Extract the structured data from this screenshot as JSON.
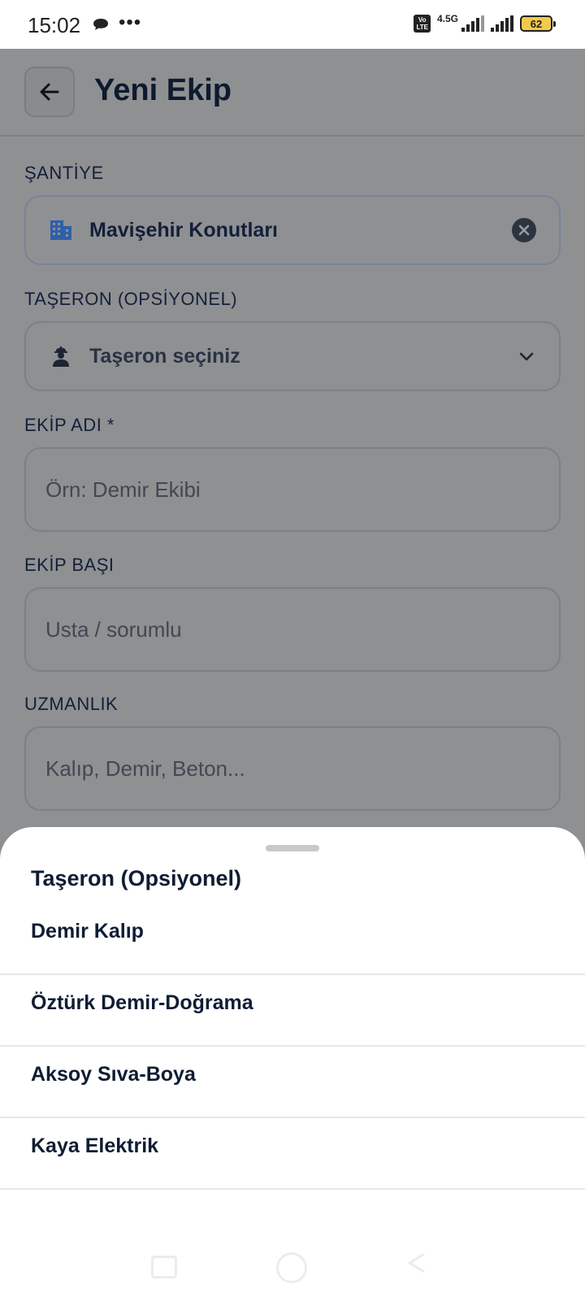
{
  "status_bar": {
    "time": "15:02",
    "network_type": "4.5G",
    "volte_label": "Vo LTE",
    "battery_level": "62",
    "icons": [
      "chat-icon",
      "more-dots-icon",
      "volte-icon",
      "signal-icon",
      "signal-icon",
      "battery-icon"
    ]
  },
  "header": {
    "title": "Yeni Ekip",
    "back_icon": "arrow-left-icon"
  },
  "form": {
    "santiye": {
      "label": "ŞANTİYE",
      "value": "Mavişehir Konutları",
      "icon": "building-icon",
      "clear_icon": "clear-circle-icon"
    },
    "taseron": {
      "label": "TAŞERON (OPSİYONEL)",
      "value": "Taşeron seçiniz",
      "icon": "worker-icon",
      "dropdown_icon": "chevron-down-icon"
    },
    "ekip_adi": {
      "label": "EKİP ADI *",
      "placeholder": "Örn: Demir Ekibi"
    },
    "ekip_basi": {
      "label": "EKİP BAŞI",
      "placeholder": "Usta / sorumlu"
    },
    "uzmanlik": {
      "label": "UZMANLIK",
      "placeholder": "Kalıp, Demir, Beton..."
    }
  },
  "sheet": {
    "title": "Taşeron (Opsiyonel)",
    "options": [
      {
        "label": "Demir Kalıp"
      },
      {
        "label": "Öztürk Demir-Doğrama"
      },
      {
        "label": "Aksoy Sıva-Boya"
      },
      {
        "label": "Kaya Elektrik"
      }
    ]
  },
  "colors": {
    "scrim": "#8f9092",
    "title_text": "#0d1a2e",
    "building_icon": "#2f5fa8",
    "sheet_bg": "#ffffff"
  }
}
